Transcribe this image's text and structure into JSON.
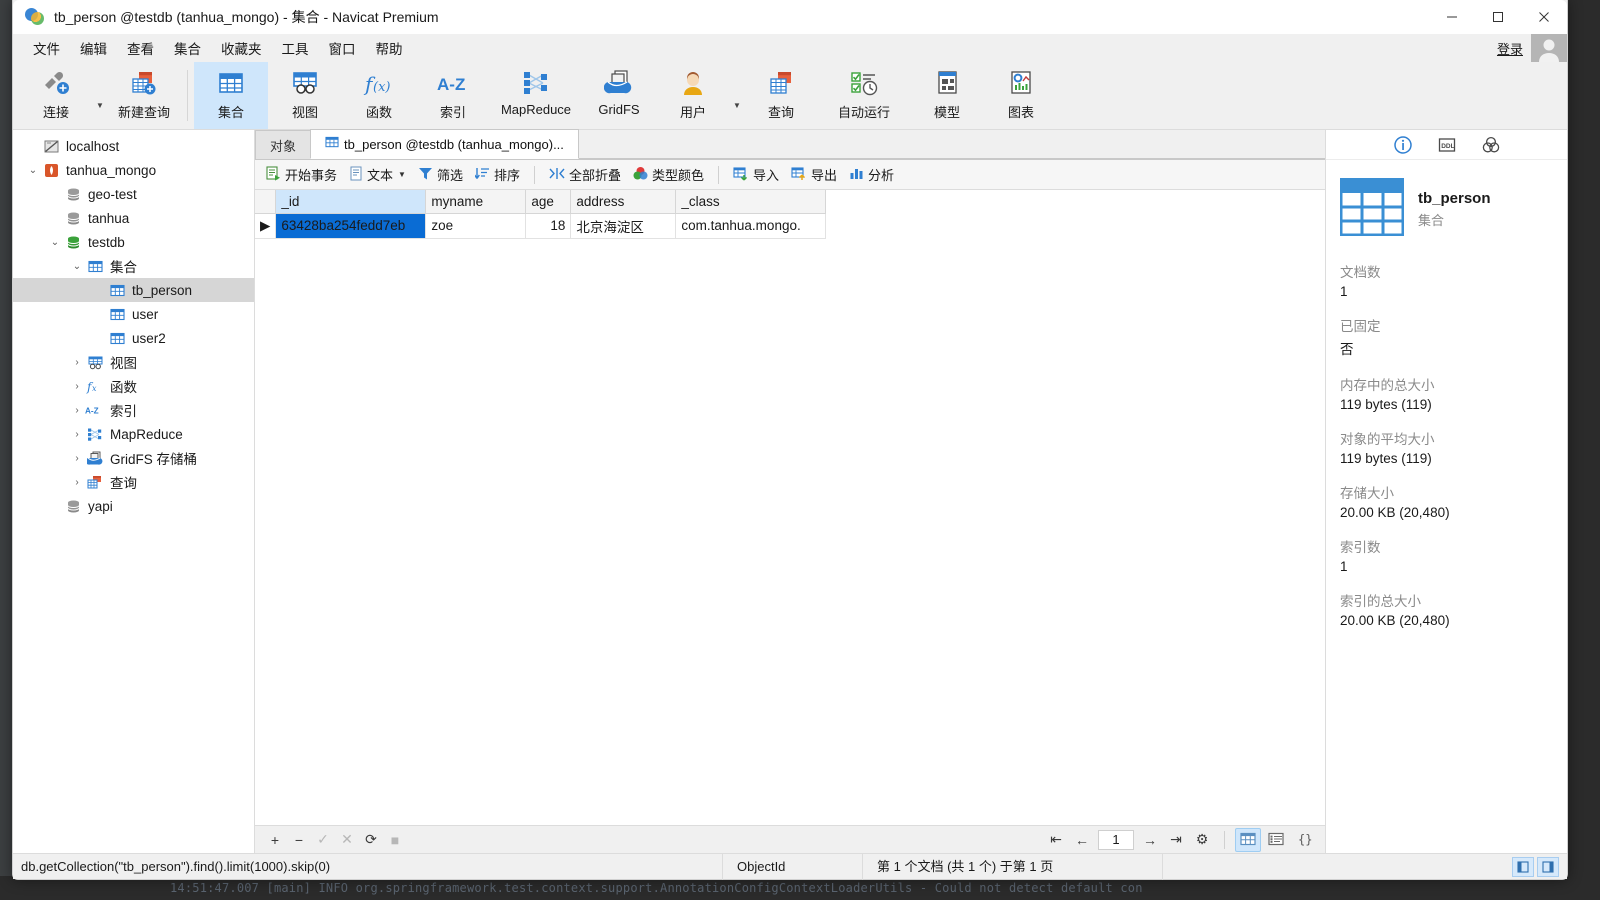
{
  "window": {
    "title": "tb_person @testdb (tanhua_mongo) - 集合 - Navicat Premium",
    "minimize": "–",
    "maximize": "□",
    "close": "✕"
  },
  "menubar": {
    "items": [
      "文件",
      "编辑",
      "查看",
      "集合",
      "收藏夹",
      "工具",
      "窗口",
      "帮助"
    ],
    "login_label": "登录"
  },
  "ribbon": {
    "buttons": [
      {
        "label": "连接",
        "icon": "connection-icon",
        "active": false,
        "caret": true
      },
      {
        "label": "新建查询",
        "icon": "new-query-icon",
        "active": false,
        "caret": false
      },
      {
        "label": "集合",
        "icon": "collection-icon",
        "active": true,
        "caret": false
      },
      {
        "label": "视图",
        "icon": "view-icon",
        "active": false,
        "caret": false
      },
      {
        "label": "函数",
        "icon": "function-icon",
        "active": false,
        "caret": false
      },
      {
        "label": "索引",
        "icon": "index-az-icon",
        "active": false,
        "caret": false
      },
      {
        "label": "MapReduce",
        "icon": "mapreduce-icon",
        "active": false,
        "caret": false
      },
      {
        "label": "GridFS",
        "icon": "gridfs-icon",
        "active": false,
        "caret": false
      },
      {
        "label": "用户",
        "icon": "user-icon",
        "active": false,
        "caret": true
      },
      {
        "label": "查询",
        "icon": "query-icon",
        "active": false,
        "caret": false
      },
      {
        "label": "自动运行",
        "icon": "automation-icon",
        "active": false,
        "caret": false
      },
      {
        "label": "模型",
        "icon": "model-icon",
        "active": false,
        "caret": false
      },
      {
        "label": "图表",
        "icon": "chart-icon",
        "active": false,
        "caret": false
      }
    ]
  },
  "sidebar": {
    "items": [
      {
        "label": "localhost",
        "icon": "server-offline-icon",
        "indent": 0,
        "twisty": "",
        "selected": false
      },
      {
        "label": "tanhua_mongo",
        "icon": "mongodb-icon",
        "indent": 0,
        "twisty": "expanded",
        "selected": false
      },
      {
        "label": "geo-test",
        "icon": "database-gray-icon",
        "indent": 1,
        "twisty": "",
        "selected": false
      },
      {
        "label": "tanhua",
        "icon": "database-gray-icon",
        "indent": 1,
        "twisty": "",
        "selected": false
      },
      {
        "label": "testdb",
        "icon": "database-green-icon",
        "indent": 1,
        "twisty": "expanded",
        "selected": false
      },
      {
        "label": "集合",
        "icon": "collection-folder-icon",
        "indent": 2,
        "twisty": "expanded",
        "selected": false
      },
      {
        "label": "tb_person",
        "icon": "table-icon",
        "indent": 3,
        "twisty": "",
        "selected": true
      },
      {
        "label": "user",
        "icon": "table-icon",
        "indent": 3,
        "twisty": "",
        "selected": false
      },
      {
        "label": "user2",
        "icon": "table-icon",
        "indent": 3,
        "twisty": "",
        "selected": false
      },
      {
        "label": "视图",
        "icon": "view-icon",
        "indent": 2,
        "twisty": "collapsed",
        "selected": false
      },
      {
        "label": "函数",
        "icon": "function-icon",
        "indent": 2,
        "twisty": "collapsed",
        "selected": false
      },
      {
        "label": "索引",
        "icon": "index-az-icon",
        "indent": 2,
        "twisty": "collapsed",
        "selected": false
      },
      {
        "label": "MapReduce",
        "icon": "mapreduce-icon",
        "indent": 2,
        "twisty": "collapsed",
        "selected": false
      },
      {
        "label": "GridFS 存储桶",
        "icon": "gridfs-icon",
        "indent": 2,
        "twisty": "collapsed",
        "selected": false
      },
      {
        "label": "查询",
        "icon": "query-icon",
        "indent": 2,
        "twisty": "collapsed",
        "selected": false
      },
      {
        "label": "yapi",
        "icon": "database-gray-icon",
        "indent": 1,
        "twisty": "",
        "selected": false
      }
    ]
  },
  "tabs": [
    {
      "label": "对象",
      "icon": "",
      "active": false
    },
    {
      "label": "tb_person @testdb (tanhua_mongo)...",
      "icon": "table-icon",
      "active": true
    }
  ],
  "grid_toolbar": {
    "buttons": [
      {
        "label": "开始事务",
        "icon": "transaction-icon",
        "caret": false
      },
      {
        "label": "文本",
        "icon": "text-icon",
        "caret": true
      },
      {
        "label": "筛选",
        "icon": "filter-icon",
        "caret": false
      },
      {
        "label": "排序",
        "icon": "sort-icon",
        "caret": false
      },
      {
        "label": "全部折叠",
        "icon": "collapse-all-icon",
        "caret": false
      },
      {
        "label": "类型颜色",
        "icon": "type-color-icon",
        "caret": false
      },
      {
        "label": "导入",
        "icon": "import-icon",
        "caret": false
      },
      {
        "label": "导出",
        "icon": "export-icon",
        "caret": false
      },
      {
        "label": "分析",
        "icon": "analyze-icon",
        "caret": false
      }
    ]
  },
  "grid": {
    "columns": [
      "_id",
      "myname",
      "age",
      "address",
      "_class"
    ],
    "rows": [
      {
        "_id": "63428ba254fedd7eb",
        "myname": "zoe",
        "age": "18",
        "address": "北京海淀区",
        "_class": "com.tanhua.mongo."
      }
    ]
  },
  "grid_bottom": {
    "add": "+",
    "remove": "−",
    "confirm": "✓",
    "cancel": "✕",
    "refresh": "⟳",
    "stop": "■",
    "page_value": "1",
    "first": "⇤",
    "prev": "←",
    "next": "→",
    "last": "⇥",
    "settings": "⚙",
    "view_grid": "grid-view-icon",
    "view_form": "form-view-icon",
    "view_json": "json-view-icon"
  },
  "infopane": {
    "tabs": [
      "info-icon",
      "ddl-icon",
      "venn-icon"
    ],
    "title": "tb_person",
    "subtitle": "集合",
    "properties": [
      {
        "key": "文档数",
        "value": "1"
      },
      {
        "key": "已固定",
        "value": "否"
      },
      {
        "key": "内存中的总大小",
        "value": "119 bytes (119)"
      },
      {
        "key": "对象的平均大小",
        "value": "119 bytes (119)"
      },
      {
        "key": "存储大小",
        "value": "20.00 KB (20,480)"
      },
      {
        "key": "索引数",
        "value": "1"
      },
      {
        "key": "索引的总大小",
        "value": "20.00 KB (20,480)"
      }
    ]
  },
  "statusbar": {
    "sql": "db.getCollection(\"tb_person\").find().limit(1000).skip(0)",
    "type": "ObjectId",
    "count": "第 1 个文档 (共 1 个) 于第 1 页"
  },
  "background_console": "14:51:47.007 [main] INFO org.springframework.test.context.support.AnnotationConfigContextLoaderUtils - Could not detect default con"
}
